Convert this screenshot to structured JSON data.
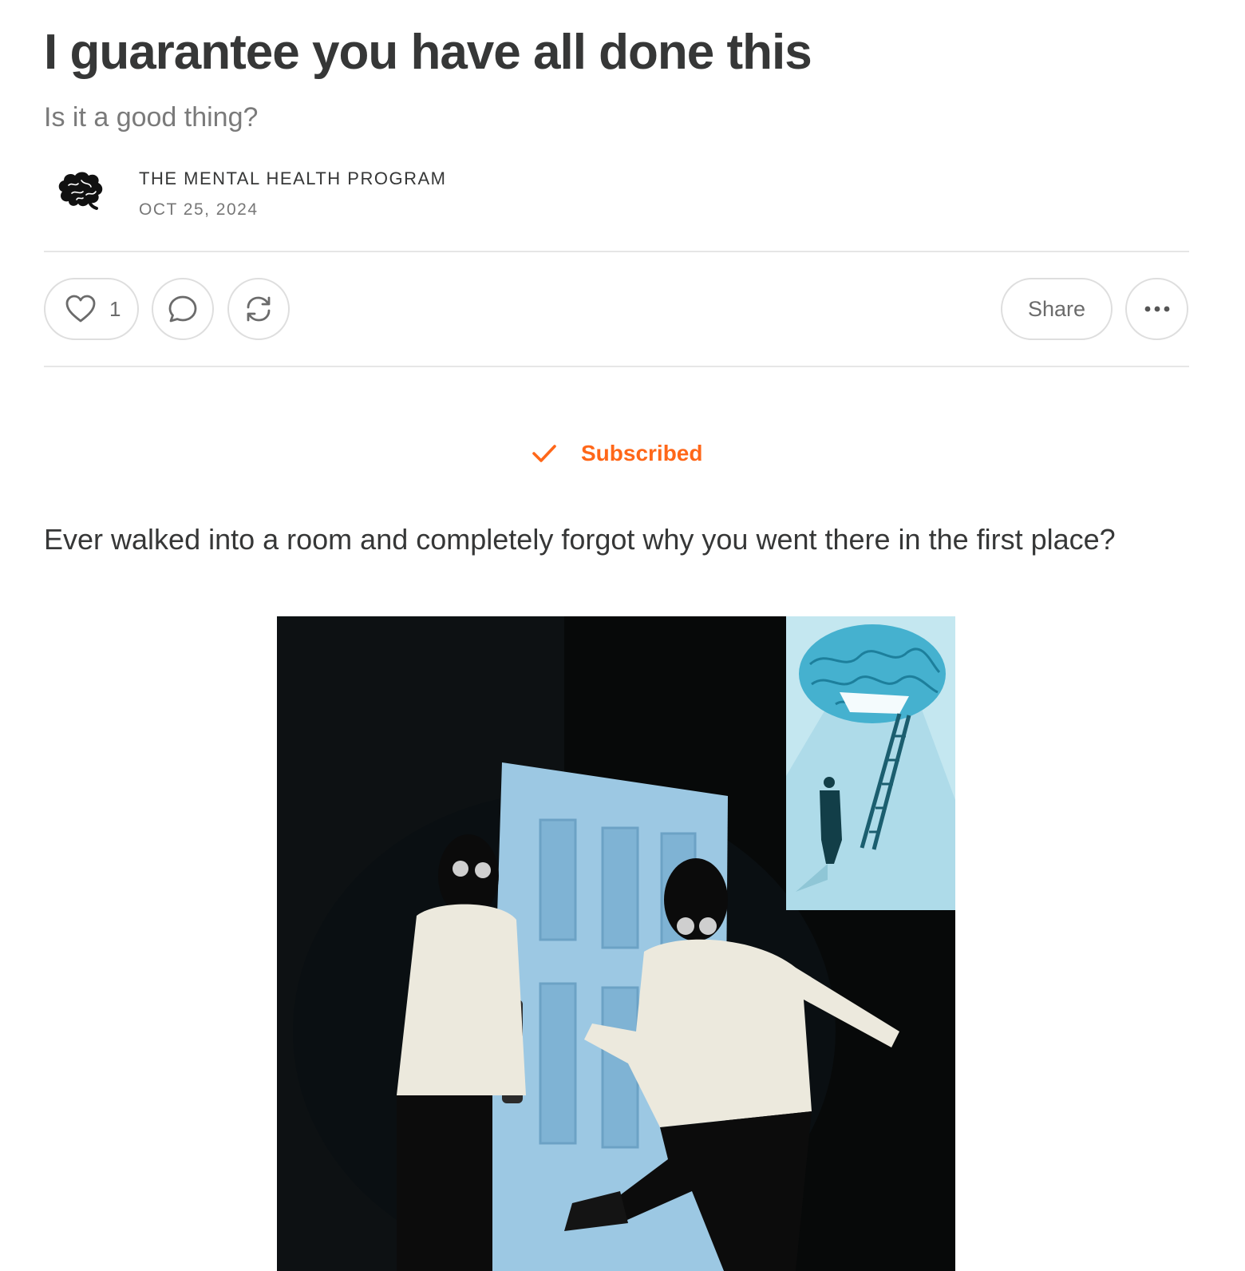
{
  "post": {
    "title": "I guarantee you have all done this",
    "subtitle": "Is it a good thing?",
    "author": "THE MENTAL HEALTH PROGRAM",
    "date": "OCT 25, 2024"
  },
  "actions": {
    "like_count": "1",
    "share_label": "Share"
  },
  "subscription": {
    "status_label": "Subscribed",
    "accent_color": "#ff6719"
  },
  "body": {
    "first_paragraph": "Ever walked into a room and completely forgot why you went there in the first place?"
  },
  "icons": {
    "avatar": "brain-icon",
    "like": "heart-icon",
    "comment": "comment-bubble-icon",
    "restack": "restack-icon",
    "more": "ellipsis-icon",
    "subscribed": "checkmark-icon"
  }
}
